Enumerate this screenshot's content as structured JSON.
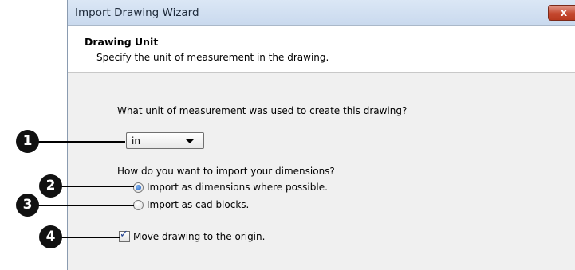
{
  "window": {
    "title": "Import Drawing Wizard",
    "close_label": "x"
  },
  "header": {
    "title": "Drawing Unit",
    "description": "Specify the unit of measurement in the drawing."
  },
  "unit": {
    "question": "What unit of measurement was used to create this drawing?",
    "selected": "in"
  },
  "dimensions": {
    "question": "How do you want to import your dimensions?",
    "options": [
      {
        "label": "Import as dimensions where possible.",
        "checked": true
      },
      {
        "label": "Import as cad blocks.",
        "checked": false
      }
    ]
  },
  "move_origin": {
    "label": "Move drawing to the origin.",
    "checked": true
  },
  "callouts": [
    "1",
    "2",
    "3",
    "4"
  ],
  "colors": {
    "titlebar": "#c9d9ee",
    "close_button": "#c4482f",
    "dialog_bg": "#f0f0f0",
    "callout": "#111111"
  }
}
